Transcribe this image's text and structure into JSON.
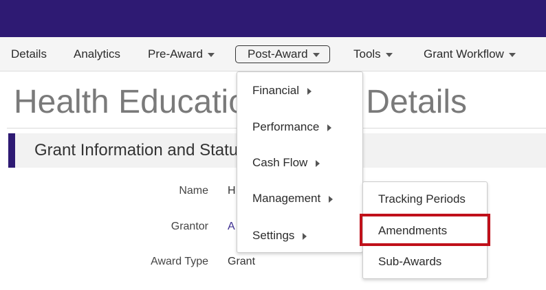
{
  "nav": {
    "items": [
      {
        "label": "Details"
      },
      {
        "label": "Analytics"
      },
      {
        "label": "Pre-Award"
      },
      {
        "label": "Post-Award"
      },
      {
        "label": "Tools"
      },
      {
        "label": "Grant Workflow"
      }
    ]
  },
  "page": {
    "title": "Health Education Grant Details"
  },
  "section": {
    "title": "Grant Information and Status"
  },
  "fields": [
    {
      "label": "Name",
      "value": "H"
    },
    {
      "label": "Grantor",
      "value": "A"
    },
    {
      "label": "Award Type",
      "value": "Grant"
    }
  ],
  "post_award_menu": {
    "items": [
      {
        "label": "Financial"
      },
      {
        "label": "Performance"
      },
      {
        "label": "Cash Flow"
      },
      {
        "label": "Management"
      },
      {
        "label": "Settings"
      }
    ]
  },
  "management_submenu": {
    "items": [
      {
        "label": "Tracking Periods"
      },
      {
        "label": "Amendments"
      },
      {
        "label": "Sub-Awards"
      }
    ]
  },
  "colors": {
    "brand": "#2e1a73",
    "highlight": "#c0101a"
  }
}
